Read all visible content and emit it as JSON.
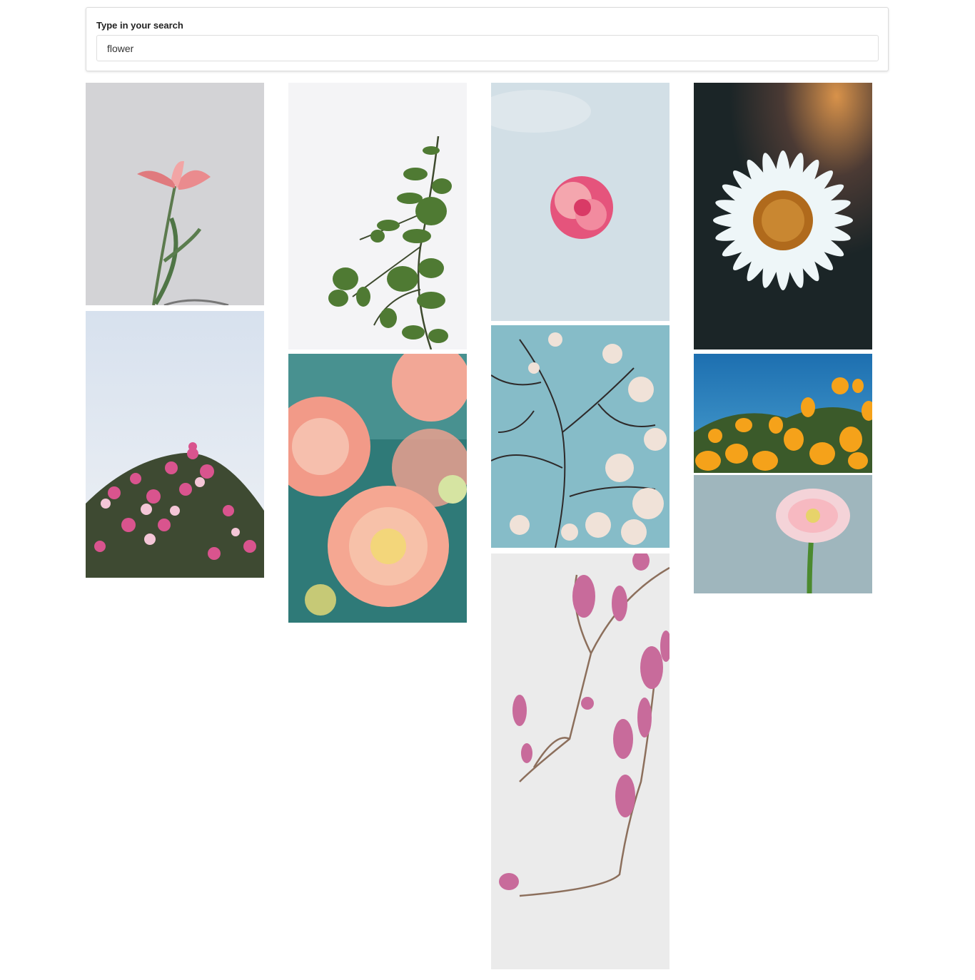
{
  "search": {
    "label": "Type in your search",
    "value": "flower"
  },
  "results": [
    {
      "icon": "pink-lily-stem-photo"
    },
    {
      "icon": "eucalyptus-branch-photo"
    },
    {
      "icon": "pink-rose-sky-photo"
    },
    {
      "icon": "white-daisy-photo"
    },
    {
      "icon": "pink-blossom-bush-photo"
    },
    {
      "icon": "peach-dahlias-photo"
    },
    {
      "icon": "magnolia-tree-photo"
    },
    {
      "icon": "orange-poppies-photo"
    },
    {
      "icon": "pink-gerbera-photo"
    },
    {
      "icon": "magnolia-branch-photo"
    }
  ]
}
